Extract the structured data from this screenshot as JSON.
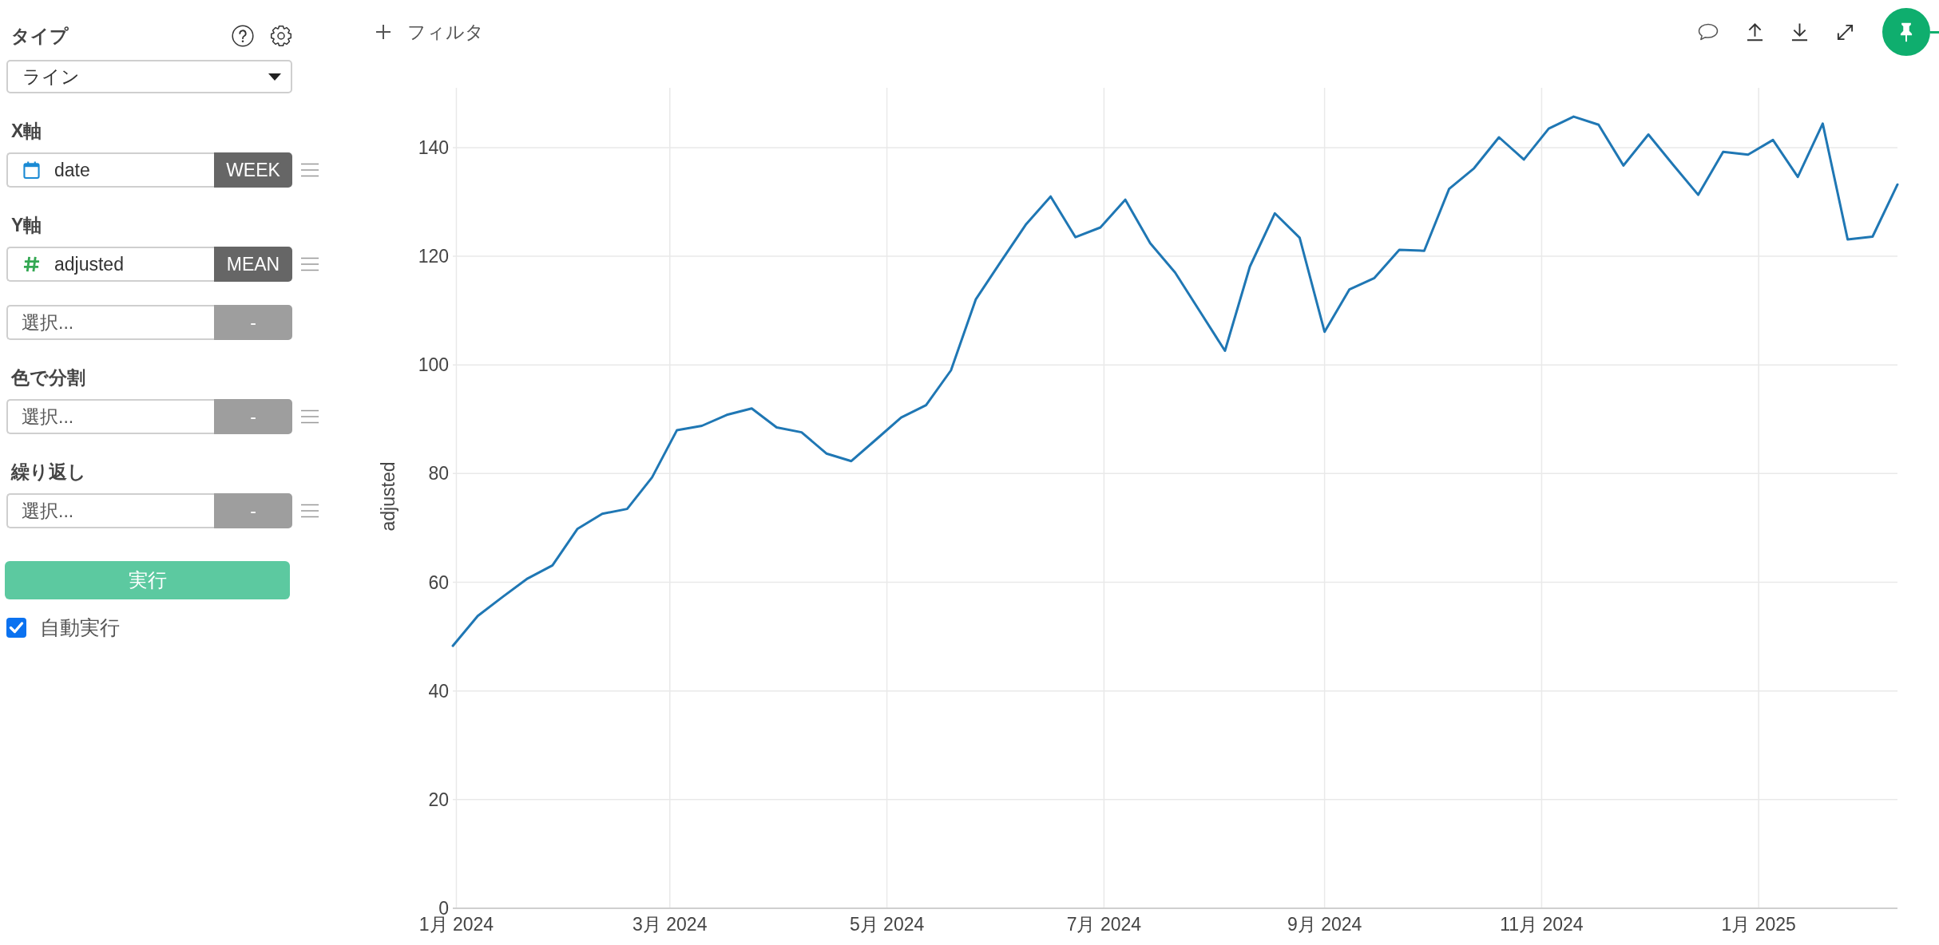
{
  "sidebar": {
    "chart_type": {
      "label": "タイプ",
      "value": "ライン"
    },
    "sections": [
      {
        "label": "X軸",
        "fields": [
          {
            "kind": "date",
            "value": "date",
            "aggregation": "WEEK",
            "draggable": true
          }
        ]
      },
      {
        "label": "Y軸",
        "fields": [
          {
            "kind": "number",
            "value": "adjusted",
            "aggregation": "MEAN",
            "draggable": true
          },
          {
            "kind": "empty",
            "placeholder": "選択...",
            "aggregation": "-",
            "draggable": false
          }
        ]
      },
      {
        "label": "色で分割",
        "fields": [
          {
            "kind": "empty",
            "placeholder": "選択...",
            "aggregation": "-",
            "draggable": true
          }
        ]
      },
      {
        "label": "繰り返し",
        "fields": [
          {
            "kind": "empty",
            "placeholder": "選択...",
            "aggregation": "-",
            "draggable": true
          }
        ]
      }
    ],
    "run_button": {
      "label": "実行"
    },
    "auto_run": {
      "label": "自動実行",
      "checked": true
    }
  },
  "toolbar": {
    "filter_button": {
      "label": "フィルタ"
    },
    "pinned": true
  },
  "chart": {
    "chart_data": {
      "type": "line",
      "ylabel": "adjusted",
      "grid": true,
      "x": [
        "2023-12-31",
        "2024-01-07",
        "2024-01-14",
        "2024-01-21",
        "2024-01-28",
        "2024-02-04",
        "2024-02-11",
        "2024-02-18",
        "2024-02-25",
        "2024-03-03",
        "2024-03-10",
        "2024-03-17",
        "2024-03-24",
        "2024-03-31",
        "2024-04-07",
        "2024-04-14",
        "2024-04-21",
        "2024-04-28",
        "2024-05-05",
        "2024-05-12",
        "2024-05-19",
        "2024-05-26",
        "2024-06-02",
        "2024-06-09",
        "2024-06-16",
        "2024-06-23",
        "2024-06-30",
        "2024-07-07",
        "2024-07-14",
        "2024-07-21",
        "2024-07-28",
        "2024-08-04",
        "2024-08-11",
        "2024-08-18",
        "2024-08-25",
        "2024-09-01",
        "2024-09-08",
        "2024-09-15",
        "2024-09-22",
        "2024-09-29",
        "2024-10-06",
        "2024-10-13",
        "2024-10-20",
        "2024-10-27",
        "2024-11-03",
        "2024-11-10",
        "2024-11-17",
        "2024-11-24",
        "2024-12-01",
        "2024-12-08",
        "2024-12-15",
        "2024-12-22",
        "2024-12-29",
        "2025-01-05",
        "2025-01-12",
        "2025-01-19",
        "2025-01-26",
        "2025-02-02",
        "2025-02-09"
      ],
      "values": [
        48.3,
        53.8,
        57.3,
        60.7,
        63.1,
        69.8,
        72.6,
        73.5,
        79.3,
        88.0,
        88.8,
        90.8,
        92.0,
        88.5,
        87.6,
        83.7,
        82.3,
        86.3,
        90.3,
        92.6,
        99.0,
        112.1,
        119.0,
        125.8,
        131.0,
        123.5,
        125.3,
        130.4,
        122.4,
        117.0,
        109.8,
        102.6,
        118.1,
        127.9,
        123.4,
        106.1,
        113.9,
        116.0,
        121.2,
        121.0,
        132.4,
        136.2,
        141.9,
        137.8,
        143.5,
        145.7,
        144.2,
        136.7,
        142.4,
        136.8,
        131.3,
        139.2,
        138.7,
        141.4,
        134.6,
        144.4,
        123.1,
        123.6,
        133.2
      ],
      "xlim": [
        "2023-12-31",
        "2025-02-09"
      ],
      "ylim": [
        0,
        151
      ],
      "xticks": [
        {
          "value": "2024-01-01",
          "label": "1月 2024"
        },
        {
          "value": "2024-03-01",
          "label": "3月 2024"
        },
        {
          "value": "2024-05-01",
          "label": "5月 2024"
        },
        {
          "value": "2024-07-01",
          "label": "7月 2024"
        },
        {
          "value": "2024-09-01",
          "label": "9月 2024"
        },
        {
          "value": "2024-11-01",
          "label": "11月 2024"
        },
        {
          "value": "2025-01-01",
          "label": "1月 2025"
        }
      ],
      "yticks": [
        0,
        20,
        40,
        60,
        80,
        100,
        120,
        140
      ]
    }
  }
}
